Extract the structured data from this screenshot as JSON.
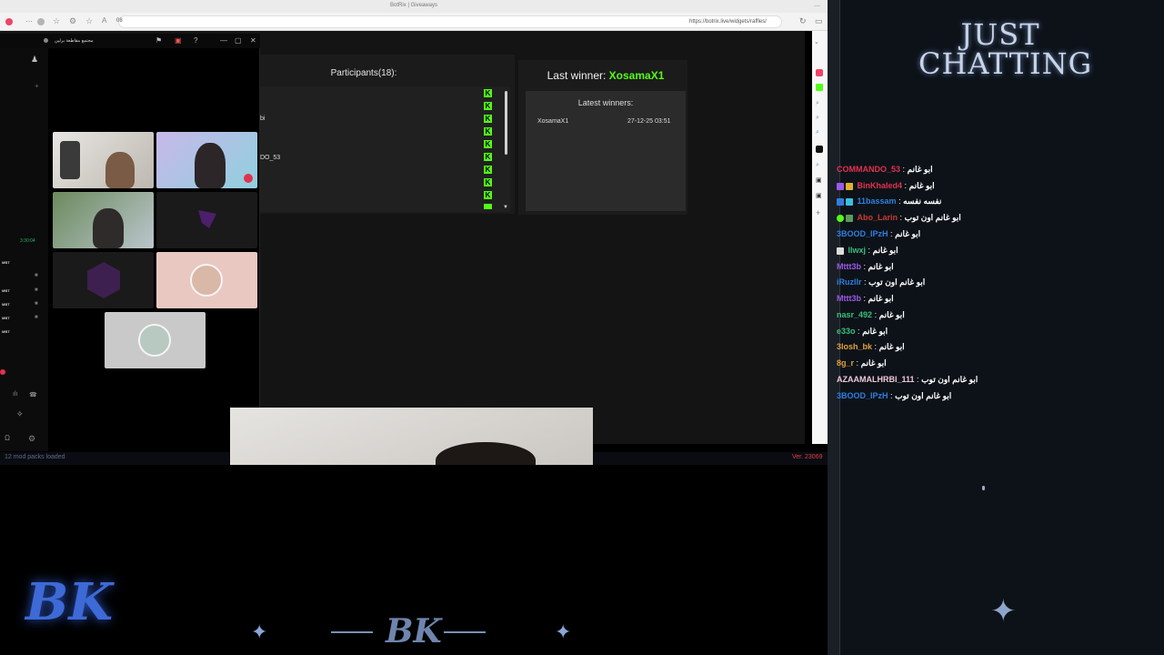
{
  "browser": {
    "tab_title": "BotRix | Giveaways",
    "address": "https://botrix.live/widgets/raffles/",
    "search_box_text": "08"
  },
  "raffle": {
    "participants_label": "Participants(18):",
    "partial_names": [
      "bi",
      "DO_53"
    ],
    "last_winner_label": "Last winner:",
    "last_winner_name": "XosamaX1",
    "latest_winners_title": "Latest winners:",
    "winners": [
      {
        "name": "XosamaX1",
        "date": "27-12-25 03:51"
      }
    ]
  },
  "discord": {
    "channel_title": "مجتمع مقاطعة برلين",
    "timer": "3:30:04",
    "voice_users": [
      "MBT",
      "MBT",
      "MBT",
      "MBT",
      "MBT"
    ]
  },
  "status": {
    "mod_packs": "12 mod packs loaded",
    "version": "Ver. 23069"
  },
  "overlay": {
    "category_title": "JUST CHATTING",
    "brand": "BK"
  },
  "chat": {
    "messages": [
      {
        "user": "COMMANDO_53",
        "color": "#e2324d",
        "text": "ابو غانم"
      },
      {
        "user": "BinKhaled4",
        "color": "#e2324d",
        "text": "ابو غانم"
      },
      {
        "user": "11bassam",
        "color": "#2f7fe0",
        "text": "نفسه نفسه"
      },
      {
        "user": "Abo_Larin",
        "color": "#c93a2e",
        "text": "ابو غانم اون توب"
      },
      {
        "user": "3BOOD_IPzH",
        "color": "#2f7fe0",
        "text": "ابو غانم"
      },
      {
        "user": "llwxj",
        "color": "#39c07b",
        "text": "ابو غانم"
      },
      {
        "user": "Mttt3b",
        "color": "#9b59e8",
        "text": "ابو غانم"
      },
      {
        "user": "iRuzllr",
        "color": "#2f7fe0",
        "text": "ابو غانم اون توب"
      },
      {
        "user": "Mttt3b",
        "color": "#9b59e8",
        "text": "ابو غانم"
      },
      {
        "user": "nasr_492",
        "color": "#39c07b",
        "text": "ابو غانم"
      },
      {
        "user": "e33o",
        "color": "#39c07b",
        "text": "ابو غانم"
      },
      {
        "user": "3losh_bk",
        "color": "#e0a33a",
        "text": "ابو غانم"
      },
      {
        "user": "8g_r",
        "color": "#e0a33a",
        "text": "ابو غانم"
      },
      {
        "user": "AZAAMALHRBI_111",
        "color": "#f0c8d8",
        "text": "ابو غانم اون توب"
      },
      {
        "user": "3BOOD_IPzH",
        "color": "#2f7fe0",
        "text": "ابو غانم اون توب"
      }
    ]
  },
  "colors": {
    "kick_green": "#53fc18",
    "page_bg": "#141414",
    "chat_bg": "#0d1219"
  }
}
